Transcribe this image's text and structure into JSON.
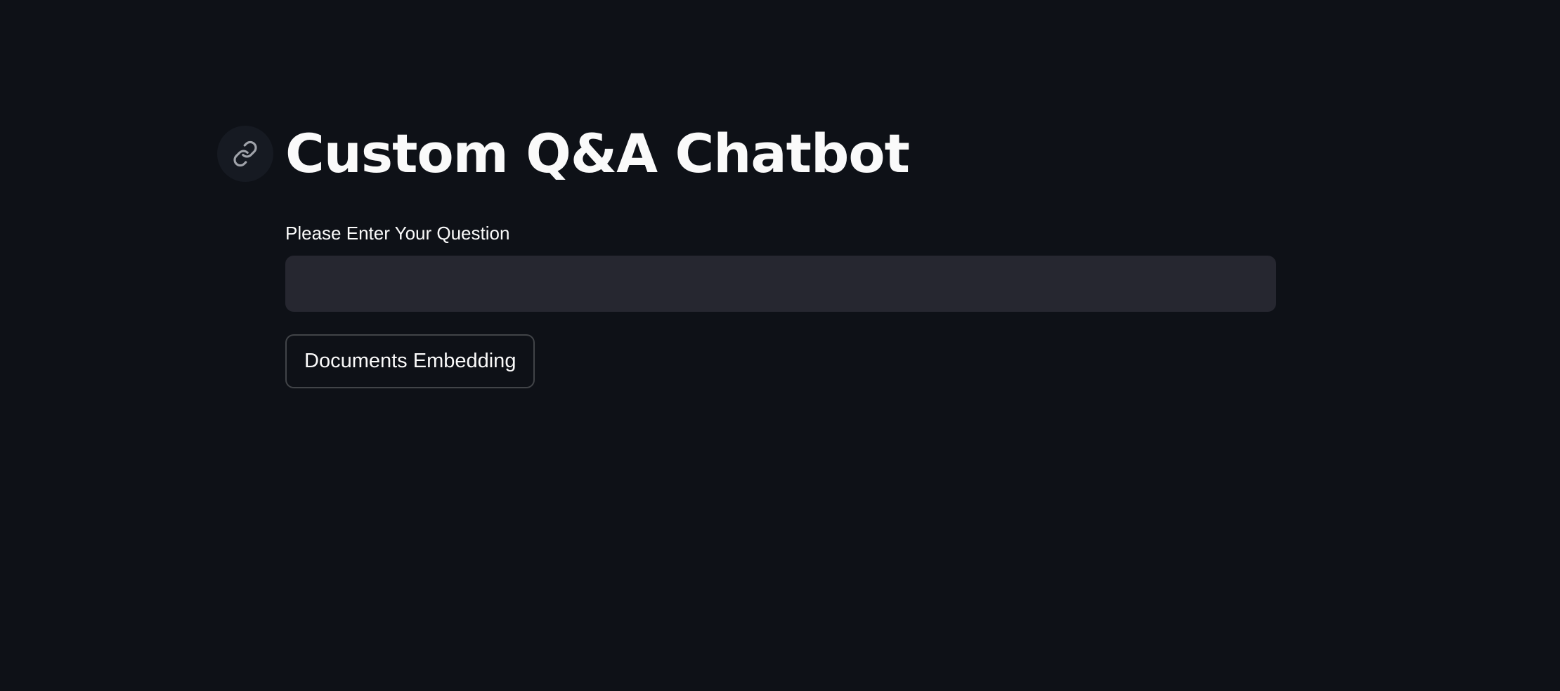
{
  "header": {
    "title": "Custom Q&A Chatbot",
    "anchor_icon": "link-icon"
  },
  "form": {
    "question_label": "Please Enter Your Question",
    "question_value": "",
    "question_placeholder": ""
  },
  "actions": {
    "embed_button_label": "Documents Embedding"
  },
  "theme": {
    "background": "#0e1117",
    "input_background": "#262730",
    "text": "#fafafa"
  }
}
